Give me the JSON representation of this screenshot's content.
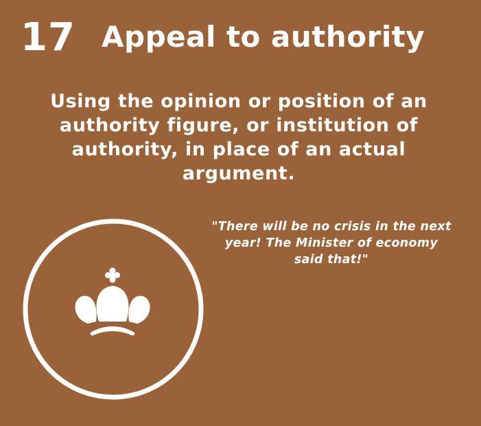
{
  "card": {
    "number": "17",
    "title": "Appeal to authority",
    "definition": "Using the opinion or position of an authority figure, or institution of authority, in place of an actual argument.",
    "example": "\"There will be no crisis in the next year! The Minister of economy said that!\"",
    "icon": "crown-icon"
  },
  "colors": {
    "background": "#9a6239",
    "foreground": "#ffffff"
  }
}
